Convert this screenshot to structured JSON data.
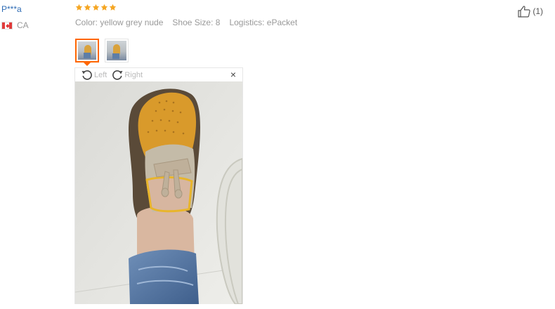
{
  "review": {
    "user_name": "P***a",
    "country_code": "CA",
    "rating": 5,
    "attributes": [
      {
        "label": "Color: yellow grey nude"
      },
      {
        "label": "Shoe Size: 8"
      },
      {
        "label": "Logistics: ePacket"
      }
    ],
    "likes": "(1)"
  },
  "viewer": {
    "rotate_left_label": "Left",
    "rotate_right_label": "Right",
    "close_label": "×"
  },
  "colors": {
    "star": "#f5a623",
    "accent": "#ff6600",
    "link": "#2d6bb4"
  },
  "icons": {
    "like": "thumbs-up-icon",
    "rotate_left": "rotate-left-icon",
    "rotate_right": "rotate-right-icon",
    "close": "close-icon",
    "flag": "canada-flag-icon"
  }
}
